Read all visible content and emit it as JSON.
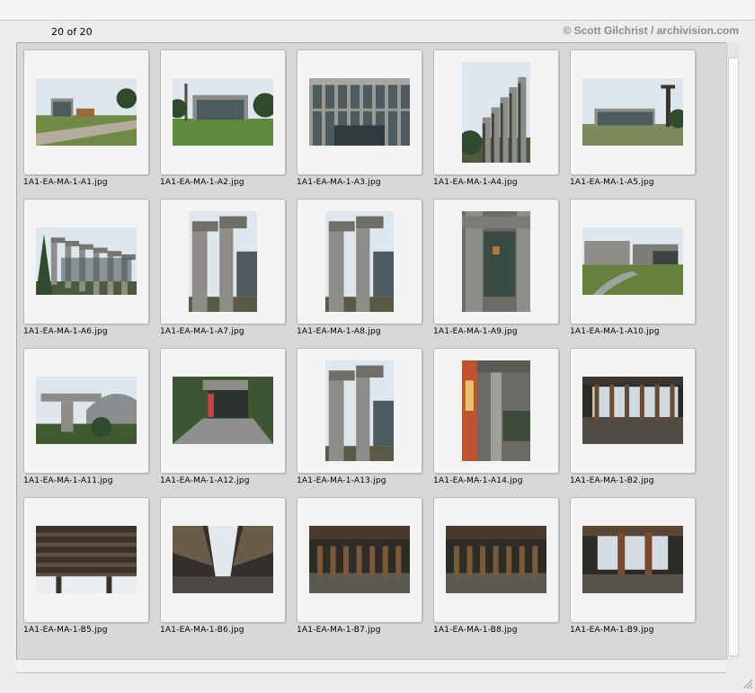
{
  "header": {
    "counter_text": "20 of 20",
    "credit_text": "© Scott Gilchrist / archivision.com"
  },
  "thumbnails": [
    {
      "filename": "1A1-EA-MA-1-A1.jpg",
      "scene": "exterior-wide"
    },
    {
      "filename": "1A1-EA-MA-1-A2.jpg",
      "scene": "exterior-lawn"
    },
    {
      "filename": "1A1-EA-MA-1-A3.jpg",
      "scene": "glass-facade"
    },
    {
      "filename": "1A1-EA-MA-1-A4.jpg",
      "scene": "stepped-tower"
    },
    {
      "filename": "1A1-EA-MA-1-A5.jpg",
      "scene": "exterior-totem"
    },
    {
      "filename": "1A1-EA-MA-1-A6.jpg",
      "scene": "beam-series"
    },
    {
      "filename": "1A1-EA-MA-1-A7.jpg",
      "scene": "beam-close"
    },
    {
      "filename": "1A1-EA-MA-1-A8.jpg",
      "scene": "beam-close"
    },
    {
      "filename": "1A1-EA-MA-1-A9.jpg",
      "scene": "column-portal"
    },
    {
      "filename": "1A1-EA-MA-1-A10.jpg",
      "scene": "courtyard"
    },
    {
      "filename": "1A1-EA-MA-1-A11.jpg",
      "scene": "entrance-canopy"
    },
    {
      "filename": "1A1-EA-MA-1-A12.jpg",
      "scene": "entrance-path"
    },
    {
      "filename": "1A1-EA-MA-1-A13.jpg",
      "scene": "beam-close"
    },
    {
      "filename": "1A1-EA-MA-1-A14.jpg",
      "scene": "column-interior"
    },
    {
      "filename": "1A1-EA-MA-1-B2.jpg",
      "scene": "great-hall"
    },
    {
      "filename": "1A1-EA-MA-1-B5.jpg",
      "scene": "ceiling-beams"
    },
    {
      "filename": "1A1-EA-MA-1-B6.jpg",
      "scene": "ceiling-skylight"
    },
    {
      "filename": "1A1-EA-MA-1-B7.jpg",
      "scene": "hall-totems"
    },
    {
      "filename": "1A1-EA-MA-1-B8.jpg",
      "scene": "hall-totems"
    },
    {
      "filename": "1A1-EA-MA-1-B9.jpg",
      "scene": "hall-window"
    }
  ]
}
